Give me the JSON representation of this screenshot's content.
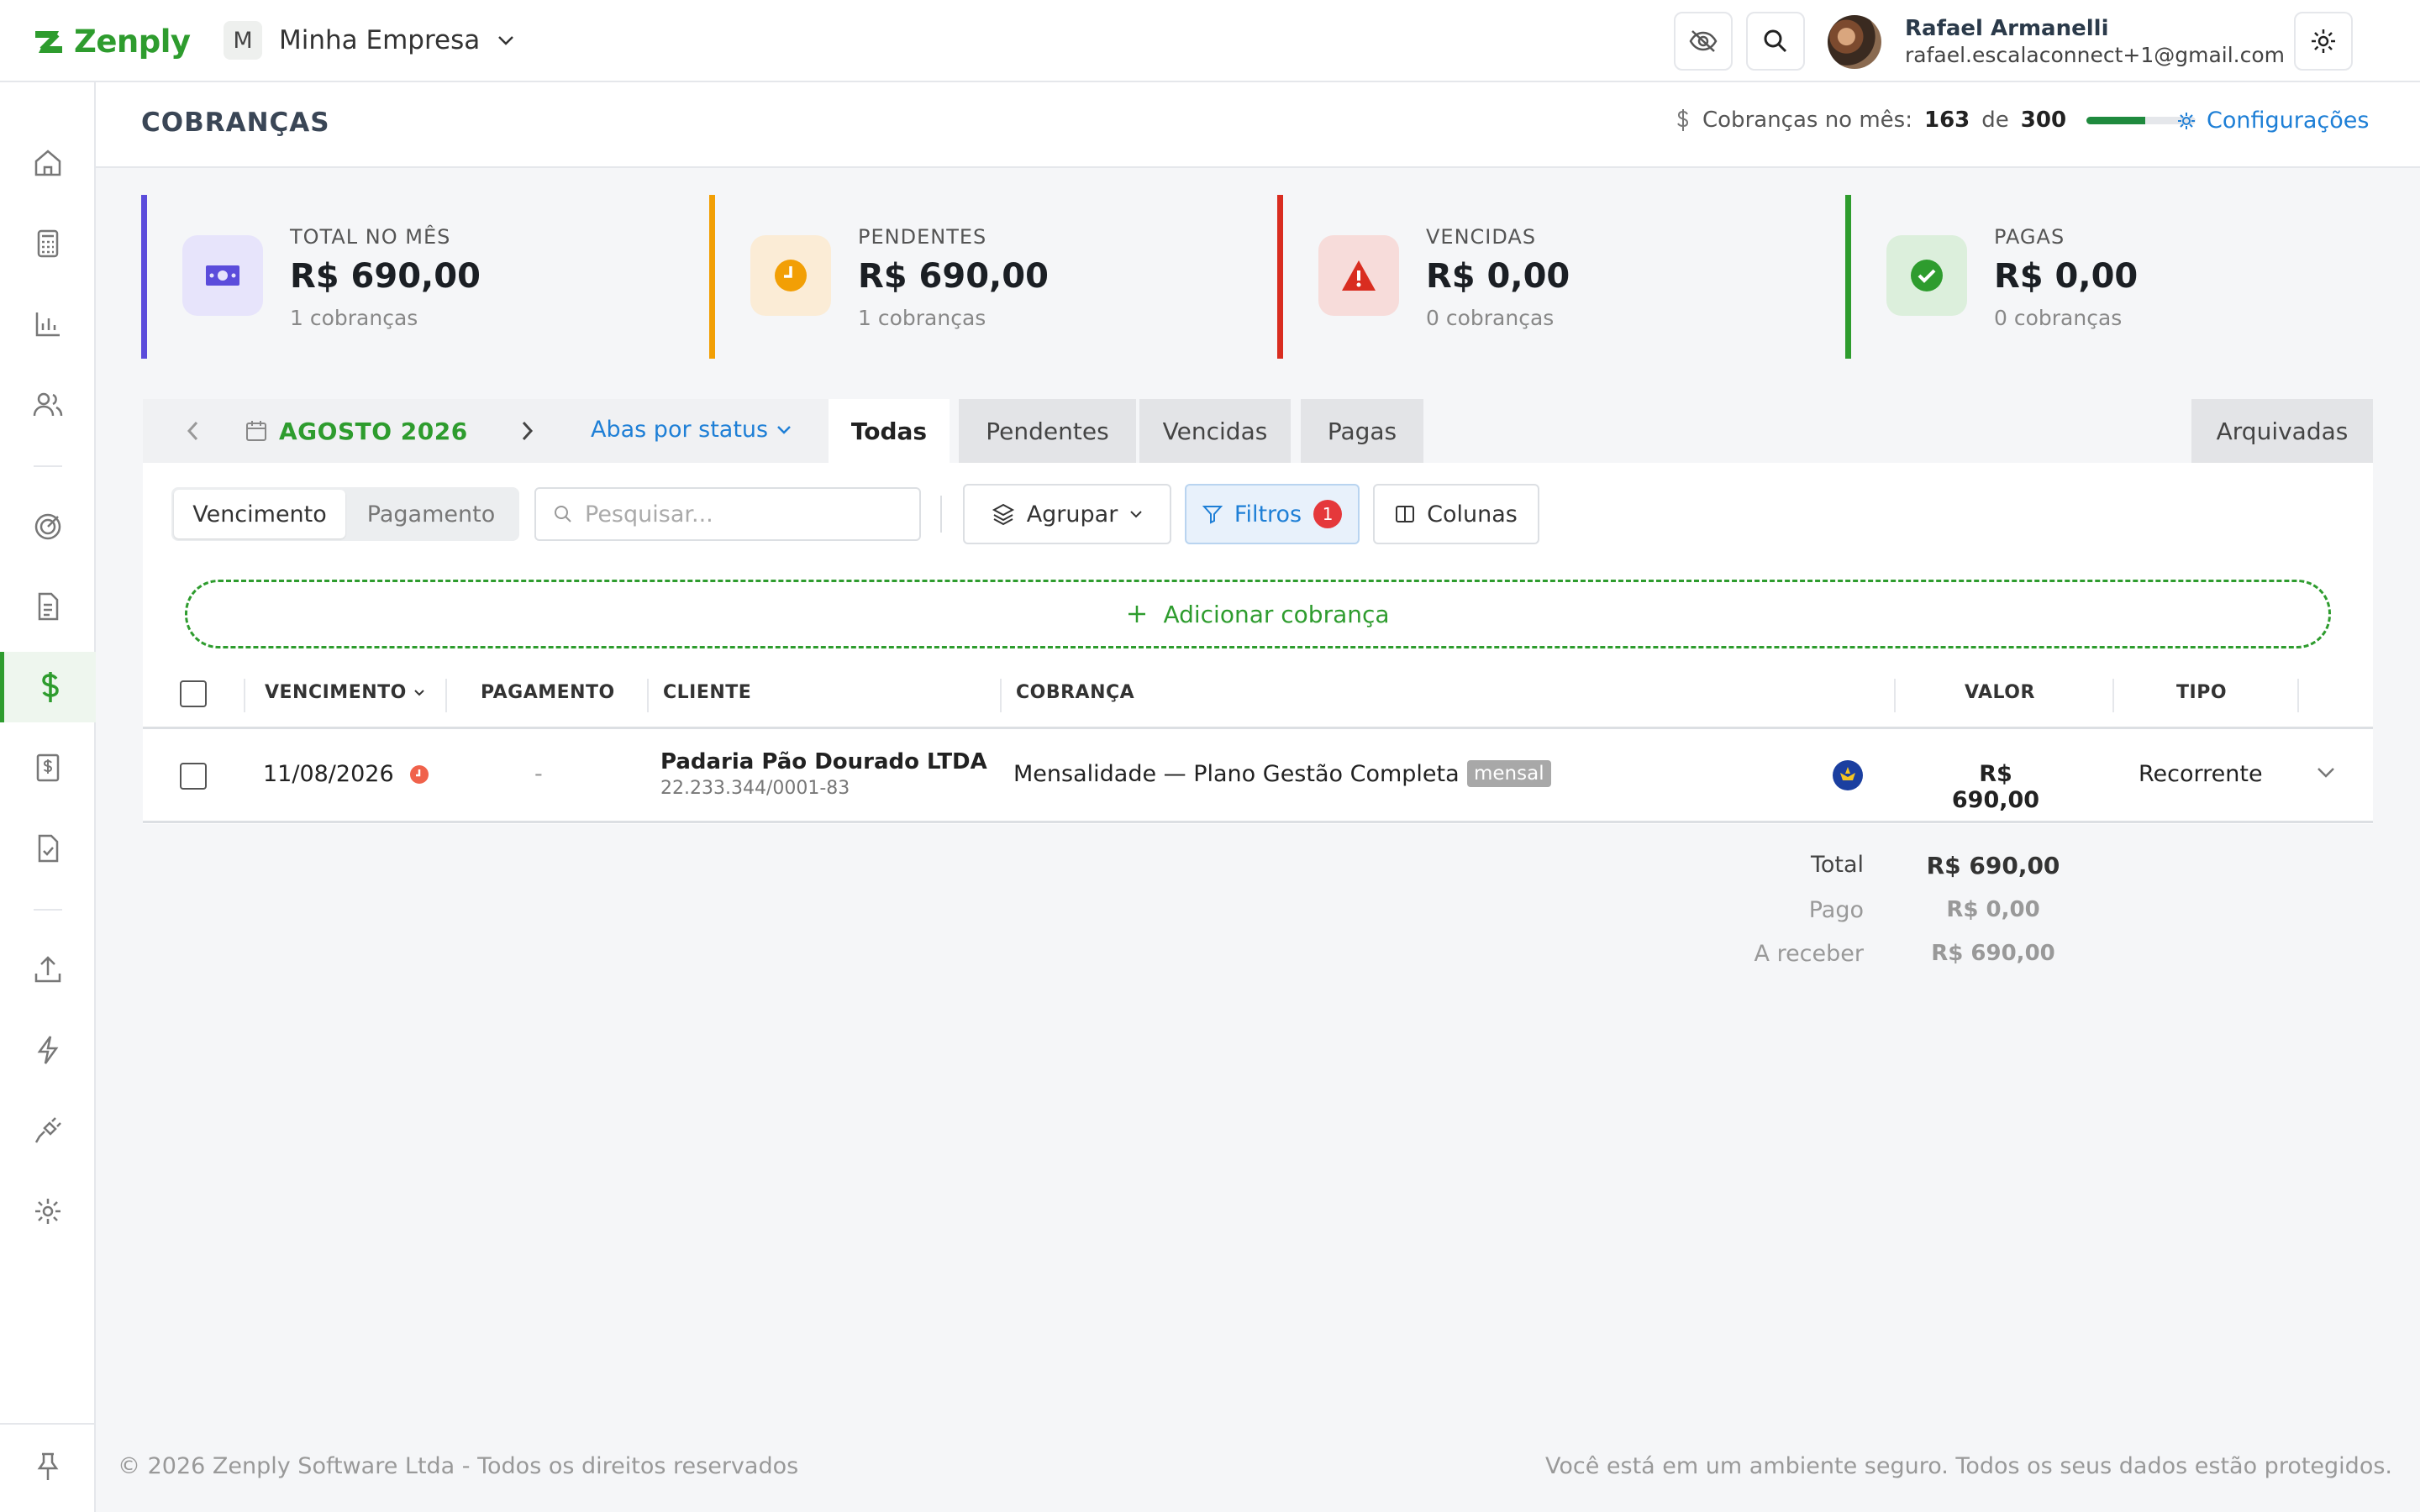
{
  "app": {
    "name": "Zenply",
    "company_initial": "M",
    "company": "Minha Empresa",
    "brand_color": "#2e9c2e"
  },
  "user": {
    "name": "Rafael Armanelli",
    "email": "rafael.escalaconnect+1@gmail.com"
  },
  "page": {
    "title": "COBRANÇAS",
    "quota_label": "Cobranças no mês:",
    "quota_used": "163",
    "quota_sep": "de",
    "quota_total": "300",
    "quota_fraction": 0.54,
    "config_label": "Configurações"
  },
  "stats": [
    {
      "label": "TOTAL NO MÊS",
      "value": "R$ 690,00",
      "sub": "1 cobranças",
      "color": "#5b4cdb",
      "icon": "money-icon"
    },
    {
      "label": "PENDENTES",
      "value": "R$ 690,00",
      "sub": "1 cobranças",
      "color": "#f29f05",
      "icon": "clock-icon"
    },
    {
      "label": "VENCIDAS",
      "value": "R$ 0,00",
      "sub": "0 cobranças",
      "color": "#d92d20",
      "icon": "warning-icon"
    },
    {
      "label": "PAGAS",
      "value": "R$ 0,00",
      "sub": "0 cobranças",
      "color": "#2e9c2e",
      "icon": "check-circle-icon"
    }
  ],
  "month_nav": {
    "label": "AGOSTO 2026"
  },
  "abas": {
    "label": "Abas por status"
  },
  "tabs": {
    "all": "Todas",
    "pending": "Pendentes",
    "overdue": "Vencidas",
    "paid": "Pagas",
    "archived": "Arquivadas"
  },
  "toolbar": {
    "seg_due": "Vencimento",
    "seg_paid": "Pagamento",
    "search_placeholder": "Pesquisar...",
    "group": "Agrupar",
    "filters": "Filtros",
    "filters_count": "1",
    "columns": "Colunas",
    "add": "Adicionar cobrança"
  },
  "table": {
    "headers": {
      "due": "VENCIMENTO",
      "payment": "PAGAMENTO",
      "client": "CLIENTE",
      "charge": "COBRANÇA",
      "value": "VALOR",
      "type": "TIPO"
    },
    "rows": [
      {
        "due": "11/08/2026",
        "payment": "-",
        "client": "Padaria Pão Dourado LTDA",
        "client_doc": "22.233.344/0001-83",
        "charge": "Mensalidade — Plano Gestão Completa",
        "tag": "mensal",
        "value": "R$ 690,00",
        "type": "Recorrente"
      }
    ]
  },
  "totals": {
    "total_label": "Total",
    "total_value": "R$ 690,00",
    "paid_label": "Pago",
    "paid_value": "R$ 0,00",
    "receivable_label": "A receber",
    "receivable_value": "R$ 690,00"
  },
  "footer": {
    "left": "© 2026 Zenply Software Ltda - Todos os direitos reservados",
    "right": "Você está em um ambiente seguro. Todos os seus dados estão protegidos."
  }
}
